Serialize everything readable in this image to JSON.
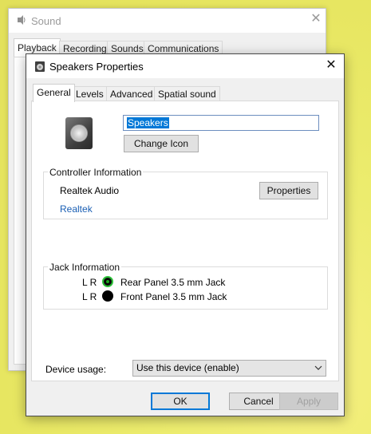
{
  "sound_window": {
    "title": "Sound",
    "tabs": [
      "Playback",
      "Recording",
      "Sounds",
      "Communications"
    ]
  },
  "dialog": {
    "title": "Speakers Properties",
    "tabs": [
      "General",
      "Levels",
      "Advanced",
      "Spatial sound"
    ],
    "device_name": "Speakers",
    "change_icon_label": "Change Icon",
    "controller": {
      "legend": "Controller Information",
      "name": "Realtek Audio",
      "properties_label": "Properties",
      "link": "Realtek"
    },
    "jack": {
      "legend": "Jack Information",
      "rows": [
        {
          "channels": "L R",
          "label": "Rear Panel 3.5 mm Jack",
          "color": "#2ec23a"
        },
        {
          "channels": "L R",
          "label": "Front Panel 3.5 mm Jack",
          "color": "#000000"
        }
      ]
    },
    "device_usage": {
      "label": "Device usage:",
      "selected": "Use this device (enable)"
    },
    "buttons": {
      "ok": "OK",
      "cancel": "Cancel",
      "apply": "Apply"
    }
  }
}
